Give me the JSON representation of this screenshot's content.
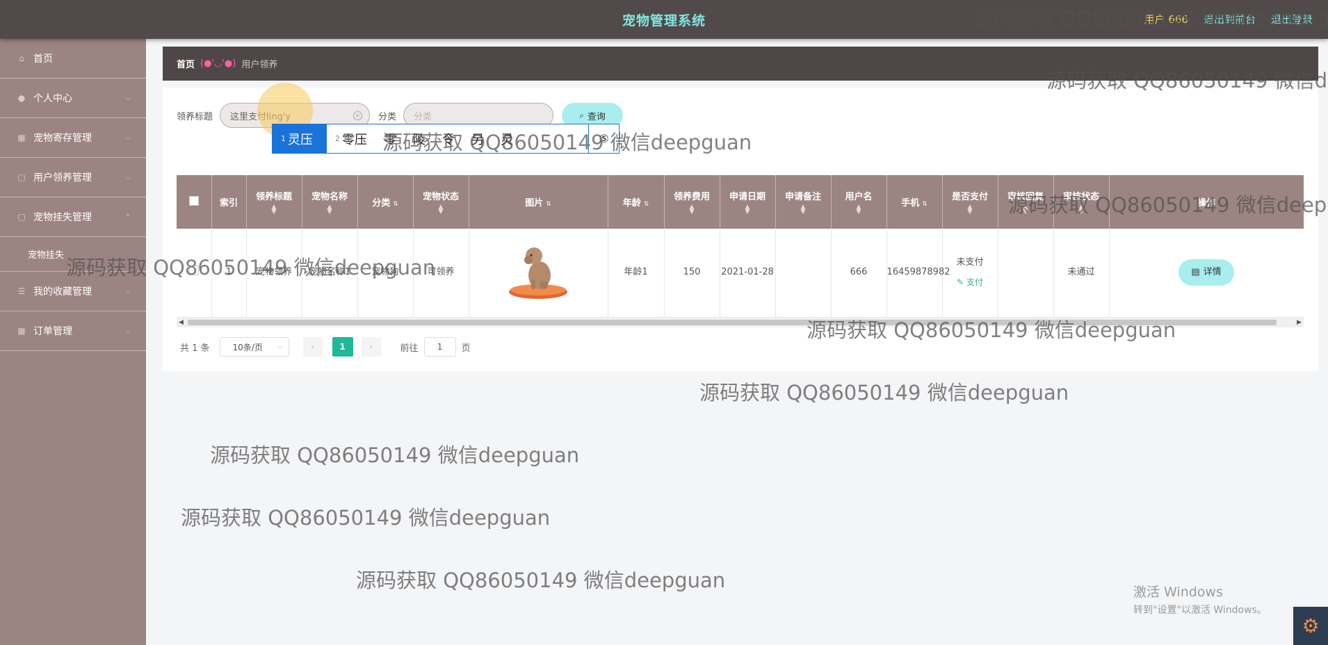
{
  "header": {
    "title": "宠物管理系统",
    "user": "用户 666",
    "back_label": "退出到前台",
    "logout_label": "退出登录"
  },
  "sidebar": {
    "items": [
      {
        "label": "首页",
        "icon": "home-icon"
      },
      {
        "label": "个人中心",
        "icon": "user-icon"
      },
      {
        "label": "宠物寄存管理",
        "icon": "grid-icon"
      },
      {
        "label": "用户领养管理",
        "icon": "doc-icon"
      },
      {
        "label": "宠物挂失管理",
        "icon": "doc-icon"
      },
      {
        "label": "宠物挂失",
        "icon": ""
      },
      {
        "label": "我的收藏管理",
        "icon": "list-icon"
      },
      {
        "label": "订单管理",
        "icon": "grid-icon"
      }
    ]
  },
  "breadcrumb": {
    "home": "首页",
    "separator": "(●'◡'●)",
    "current": "用户领养"
  },
  "search": {
    "title_label": "领养标题",
    "title_value": "这里支付ling'y",
    "category_label": "分类",
    "category_placeholder": "分类",
    "button_label": "查询"
  },
  "ime": {
    "candidates": [
      {
        "num": "1",
        "text": "灵压"
      },
      {
        "num": "2",
        "text": "零压"
      },
      {
        "num": "",
        "text": "零"
      },
      {
        "num": "",
        "text": "陵"
      },
      {
        "num": "",
        "text": "令"
      },
      {
        "num": "",
        "text": "另"
      },
      {
        "num": "",
        "text": "灵"
      }
    ],
    "more": "⑤"
  },
  "table": {
    "columns": [
      "索引",
      "领养标题",
      "宠物名称",
      "分类",
      "宠物状态",
      "图片",
      "年龄",
      "领养费用",
      "申请日期",
      "申请备注",
      "用户名",
      "手机",
      "是否支付",
      "审核回复",
      "审核状态",
      "操作"
    ],
    "row": {
      "index": "1",
      "title": "宠物领养",
      "pet_name": "宠物名称1",
      "category": "宠物狗",
      "status": "可领养",
      "age": "年龄1",
      "fee": "150",
      "date": "2021-01-28",
      "remark": "",
      "username": "666",
      "phone": "16459878982",
      "paid": "未支付",
      "pay_label": "支付",
      "reply": "",
      "audit": "未通过",
      "detail_label": "详情"
    }
  },
  "pager": {
    "total": "共 1 条",
    "page_size": "10条/页",
    "current_page": "1",
    "goto_label": "前往",
    "goto_value": "1",
    "page_suffix": "页"
  },
  "watermark": "源码获取 QQ86050149 微信deepguan",
  "windows": {
    "line1": "激活 Windows",
    "line2": "转到\"设置\"以激活 Windows。"
  },
  "colors": {
    "header_bg": "#524a4a",
    "sidebar_bg": "#9b8482",
    "accent": "#7fe7e2",
    "button": "#a9eeee",
    "pager_active": "#1db99a"
  }
}
